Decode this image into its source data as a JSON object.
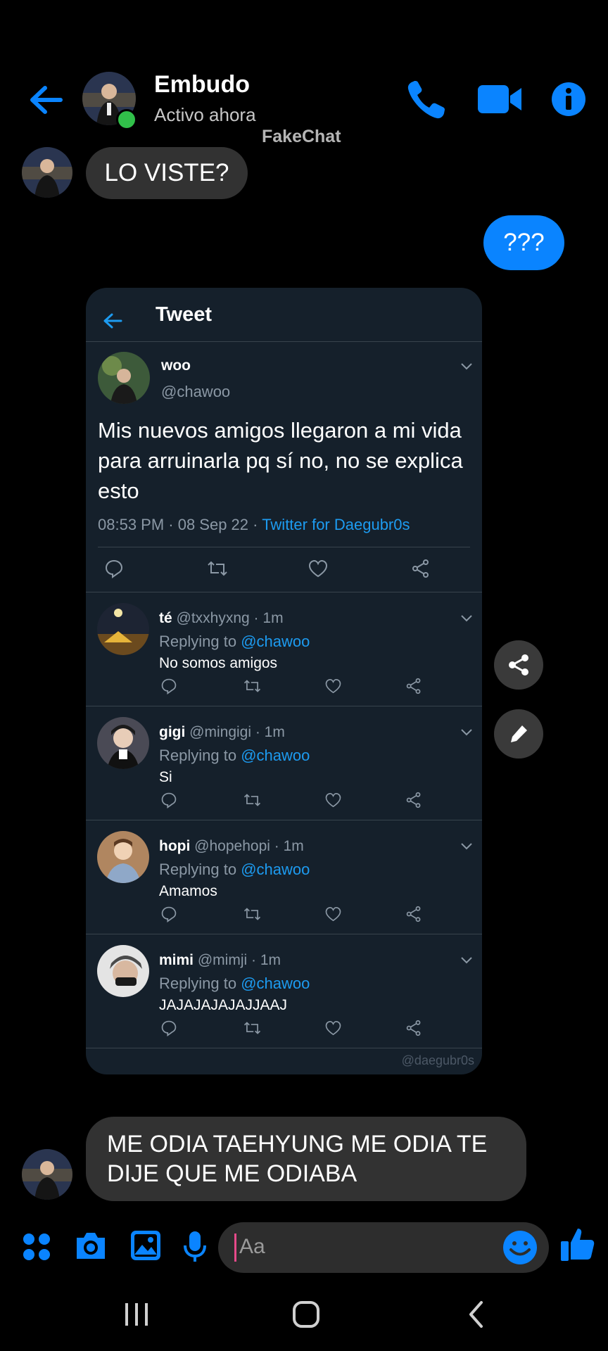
{
  "header": {
    "name": "Embudo",
    "status": "Activo ahora",
    "watermark": "FakeChat"
  },
  "messages": {
    "incoming_1": "LO VISTE?",
    "outgoing_1": "???",
    "incoming_2": "ME ODIA TAEHYUNG ME ODIA TE DIJE QUE ME ODIABA"
  },
  "tweet": {
    "header_title": "Tweet",
    "author_name": "woo",
    "author_handle": "@chawoo",
    "text": "Mis nuevos amigos llegaron a mi vida para arruinarla pq sí no, no se explica esto",
    "meta": "08:53 PM · 08 Sep 22 · ",
    "source": "Twitter for Daegubr0s",
    "footer_watermark": "@daegubr0s",
    "replies": [
      {
        "name": "té",
        "handle": "@txxhyxng · 1m",
        "replying_label": "Replying to",
        "replying_to": "@chawoo",
        "text": "No somos amigos"
      },
      {
        "name": "gigi",
        "handle": "@mingigi · 1m",
        "replying_label": "Replying to",
        "replying_to": "@chawoo",
        "text": "Si"
      },
      {
        "name": "hopi",
        "handle": "@hopehopi · 1m",
        "replying_label": "Replying to",
        "replying_to": "@chawoo",
        "text": "Amamos"
      },
      {
        "name": "mimi",
        "handle": "@mimji · 1m",
        "replying_label": "Replying to",
        "replying_to": "@chawoo",
        "text": "JAJAJAJAJAJJAAJ"
      }
    ]
  },
  "composer": {
    "placeholder": "Aa"
  },
  "colors": {
    "accent": "#0a84ff",
    "twitter_blue": "#1d9bf0",
    "tweet_bg": "#15202b",
    "bubble_bg": "#323232",
    "online": "#31c04a"
  }
}
